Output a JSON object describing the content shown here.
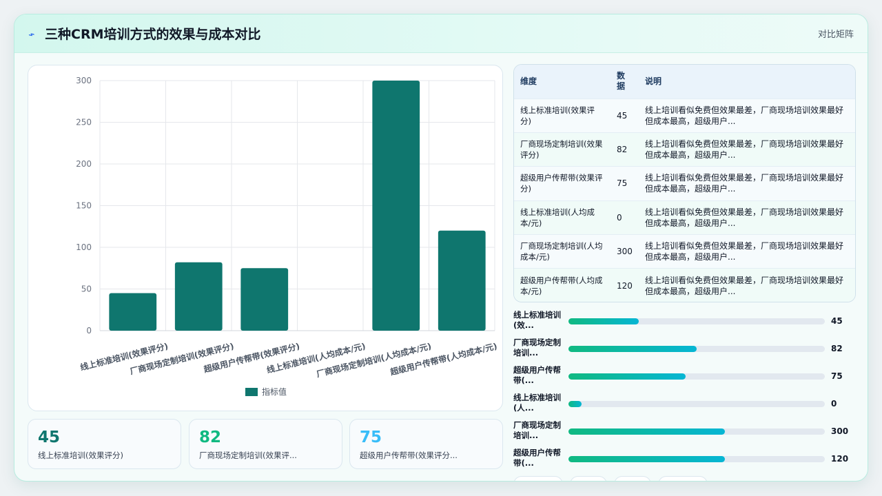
{
  "header": {
    "title": "三种CRM培训方式的效果与成本对比",
    "icon": "lightning-icon",
    "right_label": "对比矩阵"
  },
  "colors": {
    "bar": "#0f766e",
    "accent_green": "#10b981",
    "accent_cyan": "#06b6d4",
    "stat_1": "#0f766e",
    "stat_2": "#10b981",
    "stat_3": "#38bdf8"
  },
  "chart_data": {
    "type": "bar",
    "categories": [
      "线上标准培训(效果评分)",
      "厂商现场定制培训(效果评分)",
      "超级用户传帮带(效果评分)",
      "线上标准培训(人均成本/元)",
      "厂商现场定制培训(人均成本/元)",
      "超级用户传帮带(人均成本/元)"
    ],
    "series": [
      {
        "name": "指标值",
        "values": [
          45,
          82,
          75,
          0,
          300,
          120
        ]
      }
    ],
    "ylim": [
      0,
      300
    ],
    "yticks": [
      "0",
      "50",
      "100",
      "150",
      "200",
      "250",
      "300"
    ],
    "grid": true,
    "legend": "bottom"
  },
  "stats": [
    {
      "value": "45",
      "label": "线上标准培训(效果评分)"
    },
    {
      "value": "82",
      "label": "厂商现场定制培训(效果评..."
    },
    {
      "value": "75",
      "label": "超级用户传帮带(效果评分..."
    }
  ],
  "table": {
    "headers": [
      "维度",
      "数据",
      "说明"
    ],
    "rows": [
      {
        "dim": "线上标准培训(效果评分)",
        "val": "45",
        "desc": "线上培训看似免费但效果最差，厂商现场培训效果最好但成本最高，超级用户..."
      },
      {
        "dim": "厂商现场定制培训(效果评分)",
        "val": "82",
        "desc": "线上培训看似免费但效果最差，厂商现场培训效果最好但成本最高，超级用户..."
      },
      {
        "dim": "超级用户传帮带(效果评分)",
        "val": "75",
        "desc": "线上培训看似免费但效果最差，厂商现场培训效果最好但成本最高，超级用户..."
      },
      {
        "dim": "线上标准培训(人均成本/元)",
        "val": "0",
        "desc": "线上培训看似免费但效果最差，厂商现场培训效果最好但成本最高，超级用户..."
      },
      {
        "dim": "厂商现场定制培训(人均成本/元)",
        "val": "300",
        "desc": "线上培训看似免费但效果最差，厂商现场培训效果最好但成本最高，超级用户..."
      },
      {
        "dim": "超级用户传帮带(人均成本/元)",
        "val": "120",
        "desc": "线上培训看似免费但效果最差，厂商现场培训效果最好但成本最高，超级用户..."
      }
    ]
  },
  "progress": [
    {
      "label": "线上标准培训(效...",
      "value": "45",
      "fraction": 0.275
    },
    {
      "label": "厂商现场定制培训...",
      "value": "82",
      "fraction": 0.5
    },
    {
      "label": "超级用户传帮带(...",
      "value": "75",
      "fraction": 0.457
    },
    {
      "label": "线上标准培训(人...",
      "value": "0",
      "fraction": 0.05
    },
    {
      "label": "厂商现场定制培训...",
      "value": "300",
      "fraction": 0.61
    },
    {
      "label": "超级用户传帮带(...",
      "value": "120",
      "fraction": 0.61
    }
  ]
}
